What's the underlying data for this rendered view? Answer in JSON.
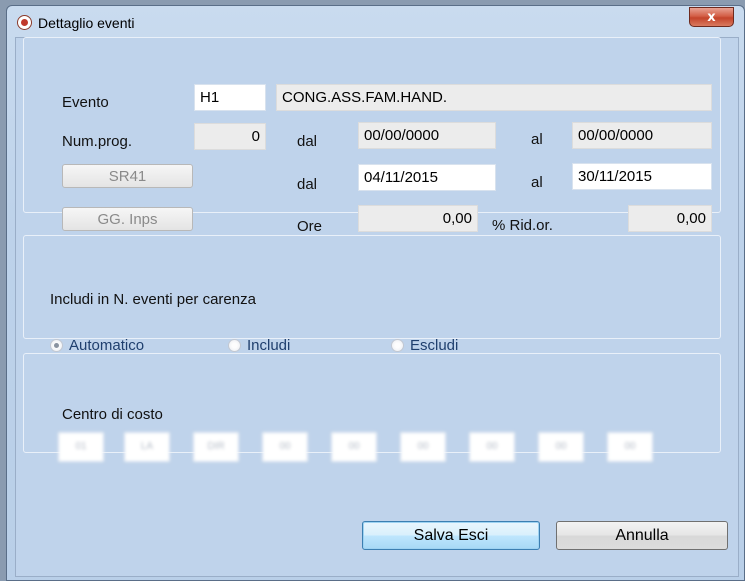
{
  "window": {
    "title": "Dettaglio eventi",
    "close_glyph": "x"
  },
  "evento": {
    "label": "Evento",
    "code": "H1",
    "description": "CONG.ASS.FAM.HAND."
  },
  "num_prog": {
    "label": "Num.prog.",
    "value": "0",
    "dal_label": "dal",
    "dal": "00/00/0000",
    "al_label": "al",
    "al": "00/00/0000"
  },
  "sr41": {
    "button": "SR41",
    "dal_label": "dal",
    "dal": "04/11/2015",
    "al_label": "al",
    "al": "30/11/2015"
  },
  "gg_inps": {
    "button": "GG. Inps",
    "ore_label": "Ore",
    "ore": "0,00",
    "rid_label": "% Rid.or.",
    "rid": "0,00"
  },
  "carenza": {
    "label": "Includi in N. eventi  per carenza",
    "options": [
      {
        "label": "Automatico",
        "selected": true
      },
      {
        "label": "Includi",
        "selected": false
      },
      {
        "label": "Escludi",
        "selected": false
      }
    ]
  },
  "centro": {
    "label": "Centro di costo",
    "boxes": [
      "01",
      "LA",
      "DIR",
      "00",
      "00",
      "00",
      "00",
      "00",
      "00"
    ]
  },
  "buttons": {
    "save": "Salva Esci",
    "cancel": "Annulla"
  }
}
